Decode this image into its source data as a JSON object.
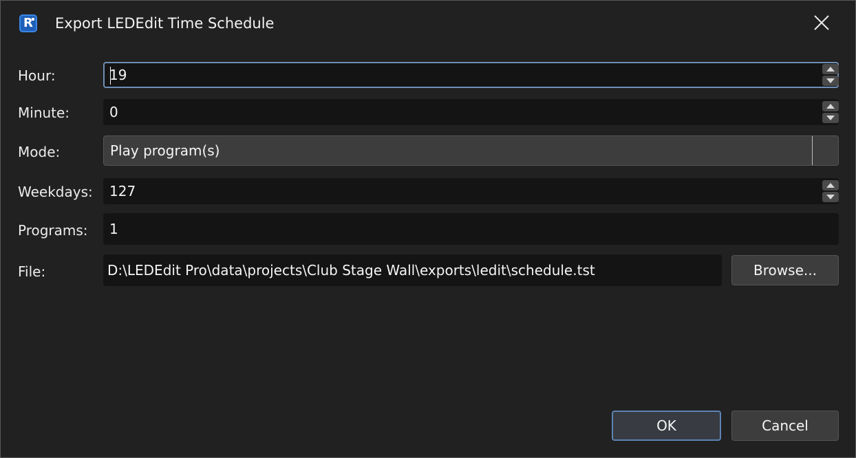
{
  "window": {
    "title": "Export LEDEdit Time Schedule",
    "app_icon_letter": "R",
    "close_icon": "close-icon"
  },
  "form": {
    "hour": {
      "label": "Hour:",
      "value": "19"
    },
    "minute": {
      "label": "Minute:",
      "value": "0"
    },
    "mode": {
      "label": "Mode:",
      "value": "Play program(s)"
    },
    "weekdays": {
      "label": "Weekdays:",
      "value": "127"
    },
    "programs": {
      "label": "Programs:",
      "value": "1"
    },
    "file": {
      "label": "File:",
      "value": "D:\\LEDEdit Pro\\data\\projects\\Club Stage Wall\\exports\\ledit\\schedule.tst"
    }
  },
  "buttons": {
    "browse": "Browse...",
    "ok": "OK",
    "cancel": "Cancel"
  },
  "colors": {
    "background": "#212121",
    "field_bg": "#141414",
    "focus_border": "#6f8fb8",
    "button_bg": "#3d3d3d"
  }
}
